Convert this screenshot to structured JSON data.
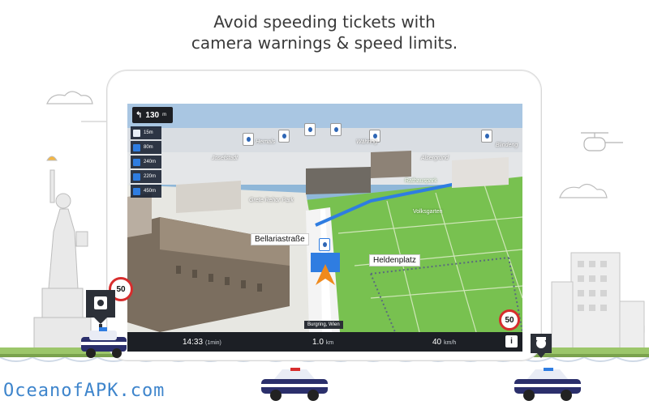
{
  "headline": {
    "line1": "Avoid speeding tickets with",
    "line2": "camera warnings & speed limits."
  },
  "nav": {
    "next_turn_distance": "130",
    "next_turn_unit": "m",
    "cameras": [
      {
        "distance": "15m"
      },
      {
        "distance": "80m"
      },
      {
        "distance": "240m"
      },
      {
        "distance": "220m"
      },
      {
        "distance": "450m"
      }
    ],
    "streets": {
      "current": "Bellariastraße",
      "cross": "Heldenplatz",
      "current_road": "Burgring, Wien"
    },
    "map_labels": [
      "Hernals",
      "Währing",
      "Josefstadt",
      "Alsergrund",
      "Rathauspark",
      "Grete Rehor Park",
      "Volksgarten",
      "Blindeng"
    ],
    "speed_limit_map": "50",
    "bottom": {
      "eta_time": "14:33",
      "eta_duration": "(1min)",
      "distance_value": "1.0",
      "distance_unit": "km",
      "speed_value": "40",
      "speed_unit": "km/h"
    },
    "info_icon_label": "i"
  },
  "scene": {
    "speed_limit_left": "50",
    "watermark": "OceanofAPK.com"
  },
  "colors": {
    "speed_sign_border": "#d72d2d",
    "route_blue": "#2f7de1",
    "nav_orange": "#f08a1c",
    "park_green": "#78c150",
    "police_blue": "#2b2f6b"
  }
}
